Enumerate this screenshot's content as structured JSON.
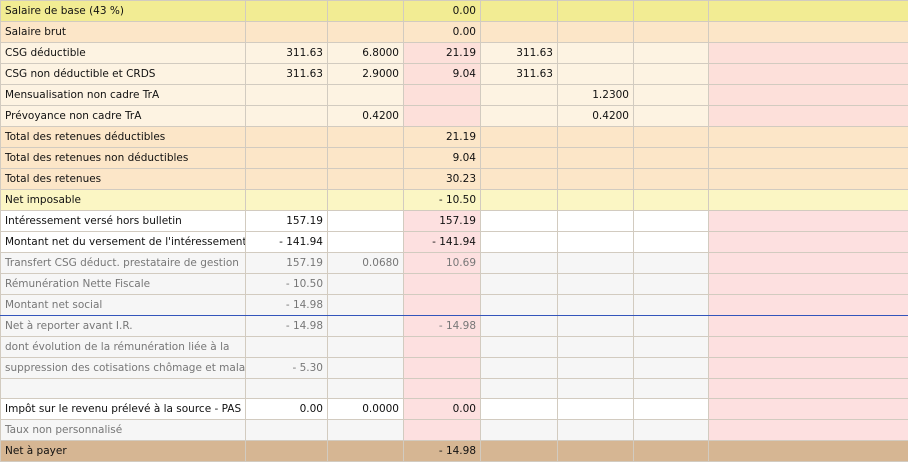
{
  "rows": [
    {
      "label": "Salaire de base (43 %)",
      "base": "",
      "taux": "",
      "montant": "0.00",
      "base_p": "",
      "taux_p": "",
      "variant": "r-yellow"
    },
    {
      "label": "Salaire brut",
      "base": "",
      "taux": "",
      "montant": "0.00",
      "base_p": "",
      "taux_p": "",
      "variant": "r-peach"
    },
    {
      "label": "CSG déductible",
      "base": "311.63",
      "taux": "6.8000",
      "montant": "21.19",
      "base_p": "311.63",
      "taux_p": "",
      "variant": "r-light"
    },
    {
      "label": "CSG non déductible et CRDS",
      "base": "311.63",
      "taux": "2.9000",
      "montant": "9.04",
      "base_p": "311.63",
      "taux_p": "",
      "variant": "r-light"
    },
    {
      "label": "Mensualisation non cadre TrA",
      "base": "",
      "taux": "",
      "montant": "",
      "base_p": "",
      "taux_p": "1.2300",
      "variant": "r-light"
    },
    {
      "label": "Prévoyance non cadre TrA",
      "base": "",
      "taux": "0.4200",
      "montant": "",
      "base_p": "",
      "taux_p": "0.4200",
      "variant": "r-light"
    },
    {
      "label": "Total des retenues déductibles",
      "base": "",
      "taux": "",
      "montant": "21.19",
      "base_p": "",
      "taux_p": "",
      "variant": "r-peach"
    },
    {
      "label": "Total des retenues non déductibles",
      "base": "",
      "taux": "",
      "montant": "9.04",
      "base_p": "",
      "taux_p": "",
      "variant": "r-peach"
    },
    {
      "label": "Total des retenues",
      "base": "",
      "taux": "",
      "montant": "30.23",
      "base_p": "",
      "taux_p": "",
      "variant": "r-peach"
    },
    {
      "label": "Net imposable",
      "base": "",
      "taux": "",
      "montant": "- 10.50",
      "base_p": "",
      "taux_p": "",
      "variant": "r-yellow2"
    },
    {
      "label": "Intéressement versé hors bulletin",
      "base": "157.19",
      "taux": "",
      "montant": "157.19",
      "base_p": "",
      "taux_p": "",
      "variant": "r-white"
    },
    {
      "label": "Montant net du versement de l'intéressement",
      "base": "- 141.94",
      "taux": "",
      "montant": "- 141.94",
      "base_p": "",
      "taux_p": "",
      "variant": "r-white"
    },
    {
      "label": "Transfert CSG déduct. prestataire de gestion",
      "base": "157.19",
      "taux": "0.0680",
      "montant": "10.69",
      "base_p": "",
      "taux_p": "",
      "variant": "r-grey"
    },
    {
      "label": "Rémunération Nette Fiscale",
      "base": "- 10.50",
      "taux": "",
      "montant": "",
      "base_p": "",
      "taux_p": "",
      "variant": "r-grey"
    },
    {
      "label": "Montant net social",
      "base": "- 14.98",
      "taux": "",
      "montant": "",
      "base_p": "",
      "taux_p": "",
      "variant": "r-grey"
    },
    {
      "label": "Net à reporter avant I.R.",
      "base": "- 14.98",
      "taux": "",
      "montant": "- 14.98",
      "base_p": "",
      "taux_p": "",
      "variant": "r-grey"
    },
    {
      "label": "dont évolution de la rémunération liée à la",
      "base": "",
      "taux": "",
      "montant": "",
      "base_p": "",
      "taux_p": "",
      "variant": "r-grey"
    },
    {
      "label": "suppression des cotisations chômage et maladie",
      "base": "- 5.30",
      "taux": "",
      "montant": "",
      "base_p": "",
      "taux_p": "",
      "variant": "r-grey"
    },
    {
      "label": "",
      "base": "",
      "taux": "",
      "montant": "",
      "base_p": "",
      "taux_p": "",
      "variant": "r-grey"
    },
    {
      "label": "Impôt sur le revenu prélevé à la source - PAS",
      "base": "0.00",
      "taux": "0.0000",
      "montant": "0.00",
      "base_p": "",
      "taux_p": "",
      "variant": "r-white"
    },
    {
      "label": "Taux non personnalisé",
      "base": "",
      "taux": "",
      "montant": "",
      "base_p": "",
      "taux_p": "",
      "variant": "r-grey"
    },
    {
      "label": "Net à payer",
      "base": "",
      "taux": "",
      "montant": "- 14.98",
      "base_p": "",
      "taux_p": "",
      "variant": "r-tan"
    }
  ]
}
